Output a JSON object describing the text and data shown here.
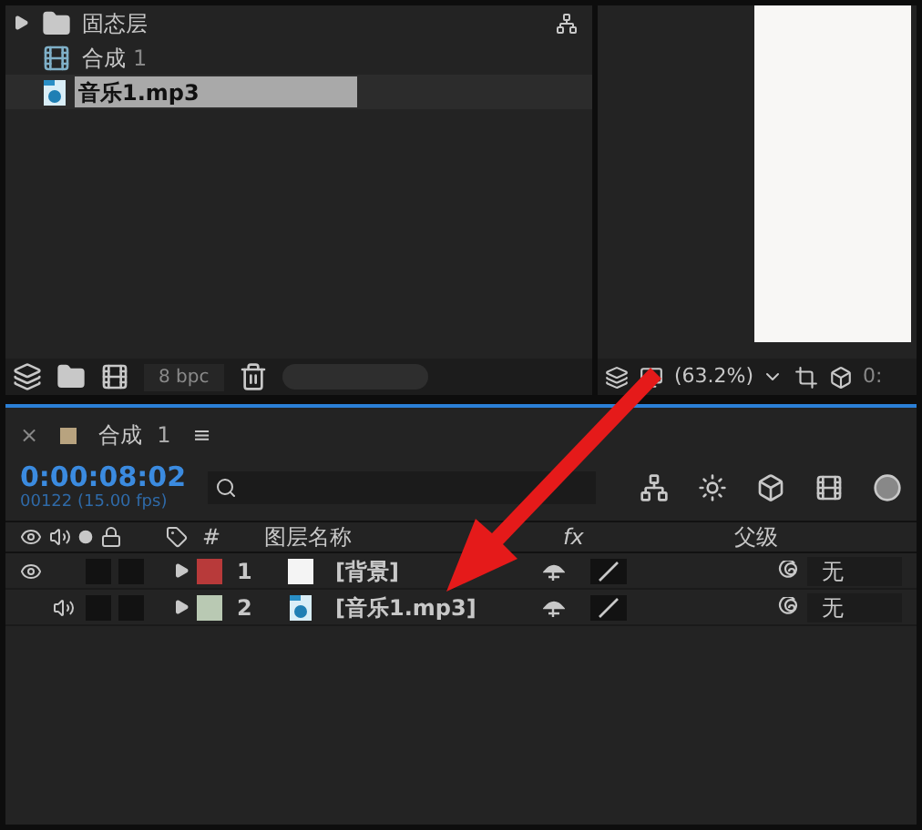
{
  "project": {
    "items": [
      {
        "kind": "folder",
        "name": "固态层",
        "selected": false
      },
      {
        "kind": "comp",
        "name": "合成",
        "suffix": "1",
        "selected": false
      },
      {
        "kind": "audio",
        "name": "音乐1.mp3",
        "selected": true
      }
    ],
    "footer": {
      "bpc": "8 bpc"
    }
  },
  "viewer": {
    "zoom": "(63.2%)",
    "timecode_fragment": "0:"
  },
  "timeline": {
    "tab": {
      "title": "合成",
      "number": "1",
      "menu": "≡",
      "close": "×"
    },
    "timecode": "0:00:08:02",
    "frame_info": "00122 (15.00 fps)",
    "columns": {
      "number": "#",
      "name": "图层名称",
      "fx": "fx",
      "parent": "父级"
    },
    "layers": [
      {
        "kind": "solid",
        "number": "1",
        "name": "[背景]",
        "color": "#b83a3a",
        "video": true,
        "audio": false,
        "parent": "无"
      },
      {
        "kind": "audio",
        "number": "2",
        "name": "[音乐1.mp3]",
        "color": "#b9c9b3",
        "video": false,
        "audio": true,
        "parent": "无"
      }
    ]
  }
}
